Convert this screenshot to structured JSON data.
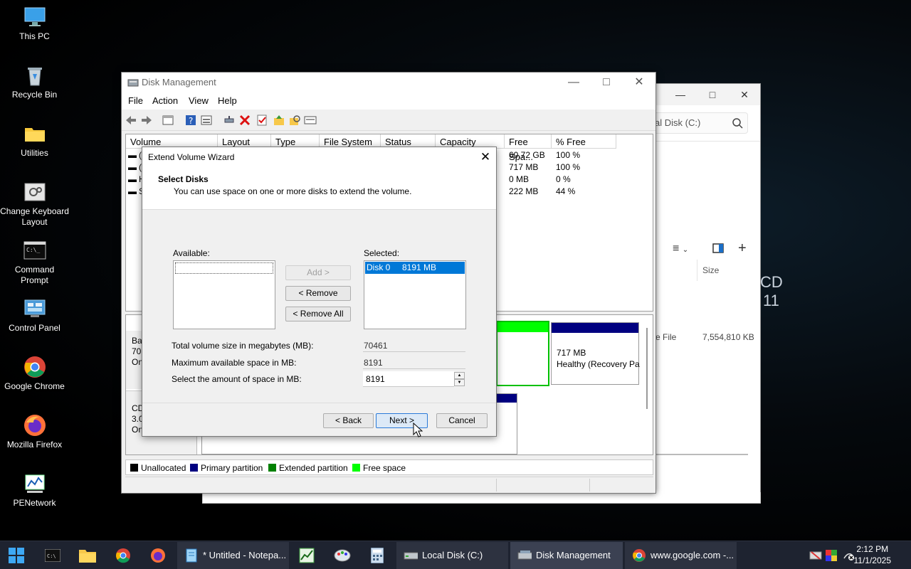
{
  "desktop": {
    "icons": [
      "This PC",
      "Recycle Bin",
      "Utilities",
      "Change Keyboard Layout",
      "Command Prompt",
      "Control Panel",
      "Google Chrome",
      "Mozilla Firefox",
      "PENetwork"
    ],
    "background_text": [
      "CD",
      "11"
    ]
  },
  "explorer": {
    "address": "al Disk (C:)",
    "column_size": "Size",
    "row_type_partial": "e File",
    "row_size": "7,554,810 KB"
  },
  "disk_management": {
    "title": "Disk Management",
    "menu": [
      "File",
      "Action",
      "View",
      "Help"
    ],
    "columns": [
      "Volume",
      "Layout",
      "Type",
      "File System",
      "Status",
      "Capacity",
      "Free Spa...",
      "% Free"
    ],
    "rows": [
      {
        "volume": "(",
        "free": "60.72 GB",
        "pct": "100 %"
      },
      {
        "volume": "(",
        "free": "717 MB",
        "pct": "100 %"
      },
      {
        "volume": "H",
        "free": "0 MB",
        "pct": "0 %"
      },
      {
        "volume": "S",
        "free": "222 MB",
        "pct": "44 %"
      }
    ],
    "disk0_label_partial": [
      "Ba",
      "70.",
      "On"
    ],
    "cdrom_label_partial": [
      "CD",
      "3.0",
      "On"
    ],
    "recovery_partition": {
      "size": "717 MB",
      "status": "Healthy (Recovery Pa"
    },
    "legend": [
      "Unallocated",
      "Primary partition",
      "Extended partition",
      "Free space"
    ],
    "colors": {
      "unallocated": "#000000",
      "primary": "#000080",
      "extended": "#008000",
      "free": "#00ff00"
    }
  },
  "wizard": {
    "title": "Extend Volume Wizard",
    "heading": "Select Disks",
    "subheading": "You can use space on one or more disks to extend the volume.",
    "available_label": "Available:",
    "selected_label": "Selected:",
    "add_button": "Add >",
    "remove_button": "< Remove",
    "remove_all_button": "< Remove All",
    "selected_items": [
      {
        "disk": "Disk 0",
        "size": "8191 MB"
      }
    ],
    "total_label": "Total volume size in megabytes (MB):",
    "total_value": "70461",
    "max_label": "Maximum available space in MB:",
    "max_value": "8191",
    "amount_label": "Select the amount of space in MB:",
    "amount_value": "8191",
    "back_button": "< Back",
    "next_button": "Next >",
    "cancel_button": "Cancel"
  },
  "taskbar": {
    "apps": [
      "* Untitled - Notepa...",
      "Local Disk (C:)",
      "Disk Management",
      "www.google.com -..."
    ],
    "time": "2:12 PM",
    "date": "11/1/2025"
  }
}
